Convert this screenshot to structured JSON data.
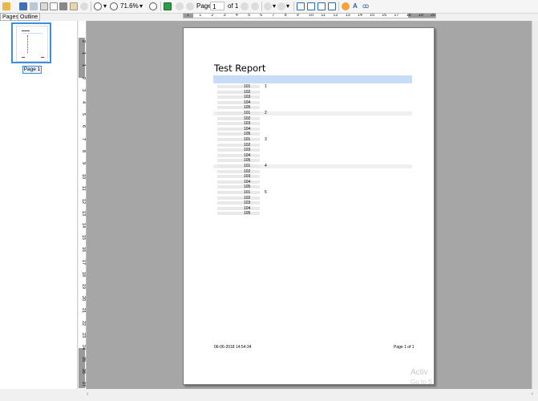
{
  "toolbar": {
    "zoom": "71.6%",
    "page_label": "Page",
    "page_value": "1",
    "page_of": "of 1"
  },
  "ruler": {
    "h_labels": [
      "1",
      "1",
      "2",
      "3",
      "4",
      "5",
      "6",
      "7",
      "8",
      "9",
      "10",
      "11",
      "12",
      "13",
      "14",
      "15",
      "16",
      "17",
      "18",
      "19",
      "20"
    ],
    "v_labels": [
      "2",
      "1",
      "1",
      "2",
      "3",
      "4",
      "5",
      "6",
      "7",
      "8",
      "9",
      "10",
      "11",
      "12",
      "13",
      "14",
      "15",
      "16",
      "17",
      "18",
      "19",
      "20",
      "21",
      "22",
      "23",
      "24",
      "25",
      "26",
      "27",
      "28",
      "29"
    ]
  },
  "tabs": {
    "pages": "Pages",
    "outline": "Outline"
  },
  "thumbnail": {
    "label": "Page 1"
  },
  "report": {
    "title": "Test Report",
    "groups": [
      {
        "key": "1",
        "rows": [
          "101",
          "102",
          "103",
          "104",
          "105"
        ]
      },
      {
        "key": "2",
        "rows": [
          "101",
          "102",
          "103",
          "104",
          "105"
        ]
      },
      {
        "key": "3",
        "rows": [
          "101",
          "102",
          "103",
          "104",
          "105"
        ]
      },
      {
        "key": "4",
        "rows": [
          "101",
          "102",
          "103",
          "104",
          "105"
        ]
      },
      {
        "key": "5",
        "rows": [
          "101",
          "102",
          "103",
          "104",
          "105"
        ]
      }
    ],
    "footer_left": "06-06-2018 14:54:34",
    "footer_right": "Page 1 of 1"
  },
  "watermark": {
    "line1": "Activ",
    "line2": "Go to S"
  },
  "colors": {
    "thumb_border": "#3b8fe0",
    "header_band": "#c6dcf7",
    "viewport_bg": "#a6a6a6"
  }
}
